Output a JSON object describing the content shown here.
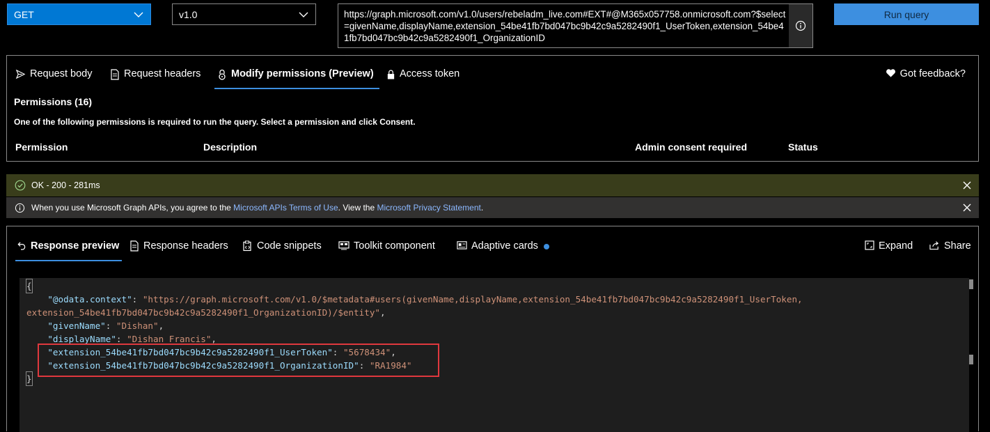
{
  "query": {
    "method": "GET",
    "version": "v1.0",
    "url": "https://graph.microsoft.com/v1.0/users/rebeladm_live.com#EXT#@M365x057758.onmicrosoft.com?$select=givenName,displayName,extension_54be41fb7bd047bc9b42c9a5282490f1_UserToken,extension_54be41fb7bd047bc9b42c9a5282490f1_OrganizationID",
    "run_label": "Run query"
  },
  "request_tabs": [
    {
      "label": "Request body",
      "icon": "send-icon"
    },
    {
      "label": "Request headers",
      "icon": "document-icon"
    },
    {
      "label": "Modify permissions (Preview)",
      "icon": "lock-icon",
      "active": true
    },
    {
      "label": "Access token",
      "icon": "key-lock-icon"
    }
  ],
  "feedback_label": "Got feedback?",
  "permissions": {
    "title": "Permissions (16)",
    "subtitle": "One of the following permissions is required to run the query. Select a permission and click Consent.",
    "columns": [
      "Permission",
      "Description",
      "Admin consent required",
      "Status"
    ]
  },
  "status_bar": {
    "text": "OK - 200 - 281ms",
    "color": "#393d1b"
  },
  "info_bar": {
    "prefix": "When you use Microsoft Graph APIs, you agree to the ",
    "link1": "Microsoft APIs Terms of Use",
    "middle": ". View the ",
    "link2": "Microsoft Privacy Statement",
    "suffix": "."
  },
  "response_tabs": [
    {
      "label": "Response preview",
      "icon": "undo-arrow-icon",
      "active": true
    },
    {
      "label": "Response headers",
      "icon": "document-icon"
    },
    {
      "label": "Code snippets",
      "icon": "code-clipboard-icon"
    },
    {
      "label": "Toolkit component",
      "icon": "toolkit-icon"
    },
    {
      "label": "Adaptive cards",
      "icon": "card-icon",
      "badge": true
    }
  ],
  "response_actions": [
    {
      "label": "Expand",
      "icon": "expand-icon"
    },
    {
      "label": "Share",
      "icon": "share-icon"
    }
  ],
  "response": {
    "open_brace": "{",
    "close_brace": "}",
    "context_key": "\"@odata.context\"",
    "context_value_line1": "\"https://graph.microsoft.com/v1.0/$metadata#users(givenName,displayName,extension_54be41fb7bd047bc9b42c9a5282490f1_UserToken,",
    "context_value_line2": "extension_54be41fb7bd047bc9b42c9a5282490f1_OrganizationID)/$entity\"",
    "given_key": "\"givenName\"",
    "given_value": "\"Dishan\"",
    "display_key": "\"displayName\"",
    "display_value": "\"Dishan Francis\"",
    "token_key": "\"extension_54be41fb7bd047bc9b42c9a5282490f1_UserToken\"",
    "token_value": "\"5678434\"",
    "org_key": "\"extension_54be41fb7bd047bc9b42c9a5282490f1_OrganizationID\"",
    "org_value": "\"RA1984\""
  }
}
